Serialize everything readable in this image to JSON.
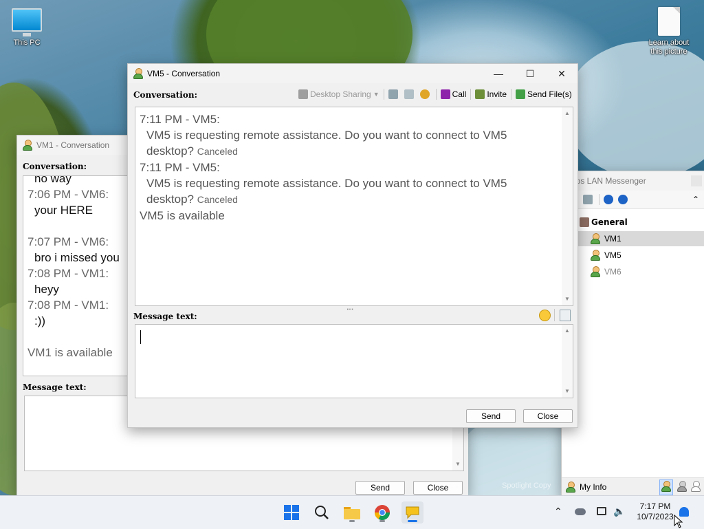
{
  "desktop": {
    "icons": [
      {
        "label": "This PC"
      },
      {
        "label": "Learn about\nthis picture"
      }
    ]
  },
  "vm1_window": {
    "title": "VM1 - Conversation",
    "conversation_label": "Conversation:",
    "messages": [
      {
        "text": "no way"
      },
      {
        "time": "7:06 PM - VM6:",
        "text": "your HERE"
      },
      {
        "time": "7:07 PM - VM6:",
        "text": "bro i missed you"
      },
      {
        "time": "7:08 PM - VM1:",
        "text": "heyy"
      },
      {
        "time": "7:08 PM - VM1:",
        "text": ":))"
      }
    ],
    "status": "VM1 is available",
    "message_label": "Message text:",
    "send_label": "Send",
    "close_label": "Close"
  },
  "vm5_window": {
    "title": "VM5 - Conversation",
    "conversation_label": "Conversation:",
    "toolbar": {
      "desktop_sharing": "Desktop Sharing",
      "call": "Call",
      "invite": "Invite",
      "send_files": "Send File(s)"
    },
    "messages": [
      {
        "time": "7:11 PM - VM5:",
        "text": "VM5 is requesting remote assistance. Do you want to connect to VM5",
        "text2": "desktop?",
        "note": "Canceled"
      },
      {
        "time": "7:11 PM - VM5:",
        "text": "VM5 is requesting remote assistance. Do you want to connect to VM5",
        "text2": "desktop?",
        "note": "Canceled"
      }
    ],
    "status": "VM5 is available",
    "splitter": "....",
    "message_label": "Message text:",
    "send_label": "Send",
    "close_label": "Close"
  },
  "messenger": {
    "title": "Itros LAN Messenger",
    "group": "General",
    "users": [
      {
        "name": "VM1",
        "state": "selected"
      },
      {
        "name": "VM5",
        "state": "online"
      },
      {
        "name": "VM6",
        "state": "away"
      }
    ],
    "my_info": "My Info",
    "wallpaper_credit": "Spotlight Copy"
  },
  "taskbar": {
    "time": "7:17 PM",
    "date": "10/7/2023",
    "apps": [
      "start",
      "search",
      "file-explorer",
      "chrome",
      "lan-messenger"
    ]
  },
  "colors": {
    "accent": "#1a73e8",
    "online_green": "#5aa64a",
    "text_gray": "#555555"
  }
}
